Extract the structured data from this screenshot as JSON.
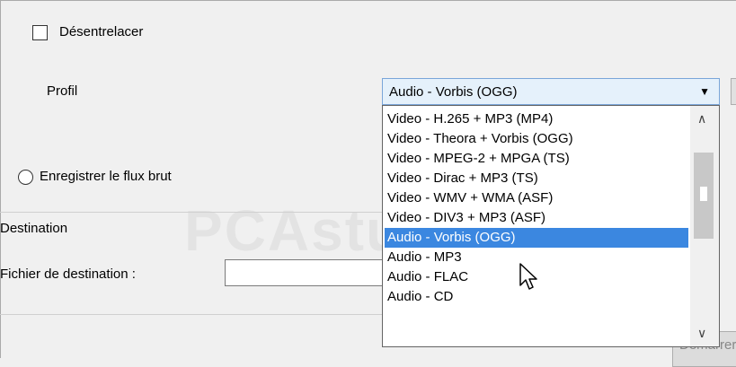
{
  "options": {
    "deinterlace_label": "Désentrelacer",
    "profile_label": "Profil",
    "raw_stream_label": "Enregistrer le flux brut"
  },
  "destination": {
    "section_label": "Destination",
    "file_label": "Fichier de destination :",
    "file_value": ""
  },
  "profile_select": {
    "selected": "Audio - Vorbis (OGG)",
    "dropdown_items": [
      "Video - H.265 + MP3 (MP4)",
      "Video - Theora + Vorbis (OGG)",
      "Video - MPEG-2 + MPGA (TS)",
      "Video - Dirac + MP3 (TS)",
      "Video - WMV + WMA (ASF)",
      "Video - DIV3 + MP3 (ASF)",
      "Audio - Vorbis (OGG)",
      "Audio - MP3",
      "Audio - FLAC",
      "Audio - CD"
    ],
    "highlighted_index": 6
  },
  "buttons": {
    "start_label": "Démarrer"
  },
  "watermark": "PCAstuces",
  "colors": {
    "highlight": "#3b87e0",
    "select_bg": "#e5f1fb"
  }
}
